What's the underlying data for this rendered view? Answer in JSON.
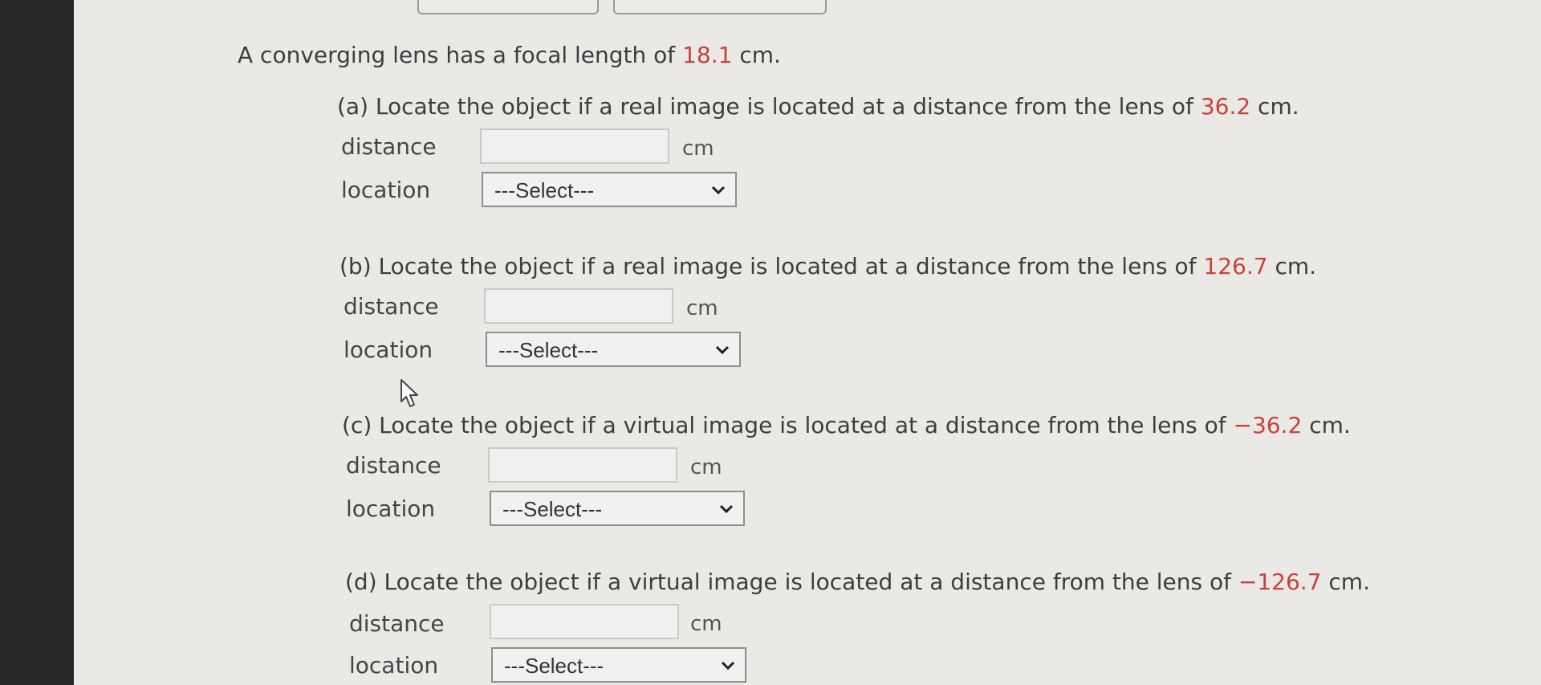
{
  "statement": {
    "prefix": "A converging lens has a focal length of ",
    "focal_length": "18.1",
    "suffix": " cm."
  },
  "parts": [
    {
      "prefix": "(a) Locate the object if a real image is located at a distance from the lens of ",
      "value": "36.2",
      "suffix": " cm.",
      "distance_label": "distance",
      "distance_value": "",
      "unit": "cm",
      "location_label": "location",
      "location_selected": "---Select---"
    },
    {
      "prefix": "(b) Locate the object if a real image is located at a distance from the lens of ",
      "value": "126.7",
      "suffix": " cm.",
      "distance_label": "distance",
      "distance_value": "",
      "unit": "cm",
      "location_label": "location",
      "location_selected": "---Select---"
    },
    {
      "prefix": "(c) Locate the object if a virtual image is located at a distance from the lens of ",
      "value": "−36.2",
      "suffix": " cm.",
      "distance_label": "distance",
      "distance_value": "",
      "unit": "cm",
      "location_label": "location",
      "location_selected": "---Select---"
    },
    {
      "prefix": "(d) Locate the object if a virtual image is located at a distance from the lens of ",
      "value": "−126.7",
      "suffix": " cm.",
      "distance_label": "distance",
      "distance_value": "",
      "unit": "cm",
      "location_label": "location",
      "location_selected": "---Select---"
    }
  ],
  "colors": {
    "accent_red": "#c8423b",
    "bezel": "#272729"
  },
  "icons": {
    "cursor": "mouse-pointer-icon",
    "dropdown": "chevron-down-icon"
  }
}
